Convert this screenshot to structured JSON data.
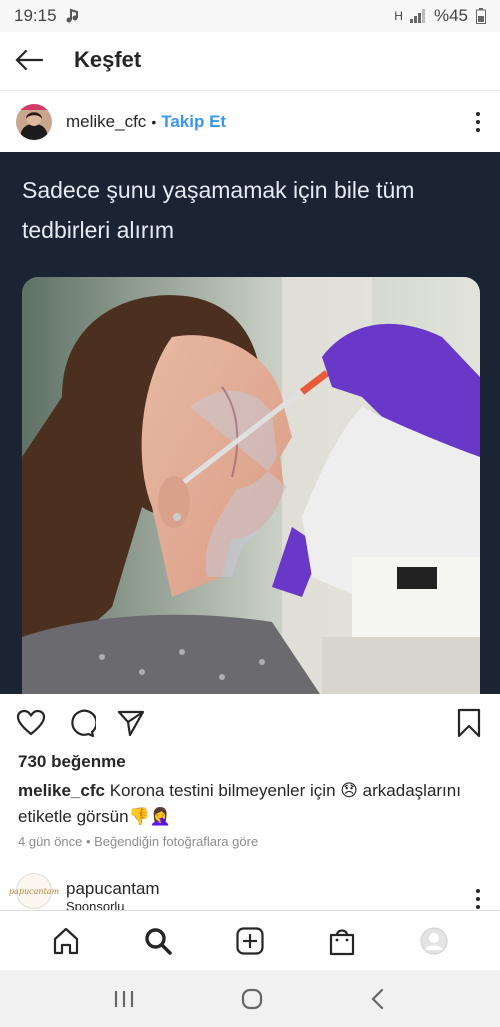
{
  "status_bar": {
    "time": "19:15",
    "battery": "%45",
    "network": "H"
  },
  "header": {
    "title": "Keşfet"
  },
  "post": {
    "username": "melike_cfc",
    "follow_label": "Takip Et",
    "overlay_text": "Sadece şunu yaşamamak için bile tüm tedbirleri alırım",
    "likes": "730 beğenme",
    "caption_user": "melike_cfc",
    "caption_text": "Korona testini bilmeyenler için 😞 arkadaşlarını etiketle görsün👎🤦‍♀️",
    "meta": "4 gün önce • Beğendiğin fotoğraflara göre"
  },
  "next_post": {
    "username": "papucantam",
    "subtitle": "Sponsorlu",
    "avatar_text": "papucantam"
  },
  "bottom_nav": {
    "items": [
      "home-icon",
      "search-icon",
      "add-post-icon",
      "shop-icon",
      "profile-icon"
    ]
  },
  "colors": {
    "accent": "#3897f0",
    "media_bg": "#1a2433",
    "glove": "#6a38c8"
  }
}
